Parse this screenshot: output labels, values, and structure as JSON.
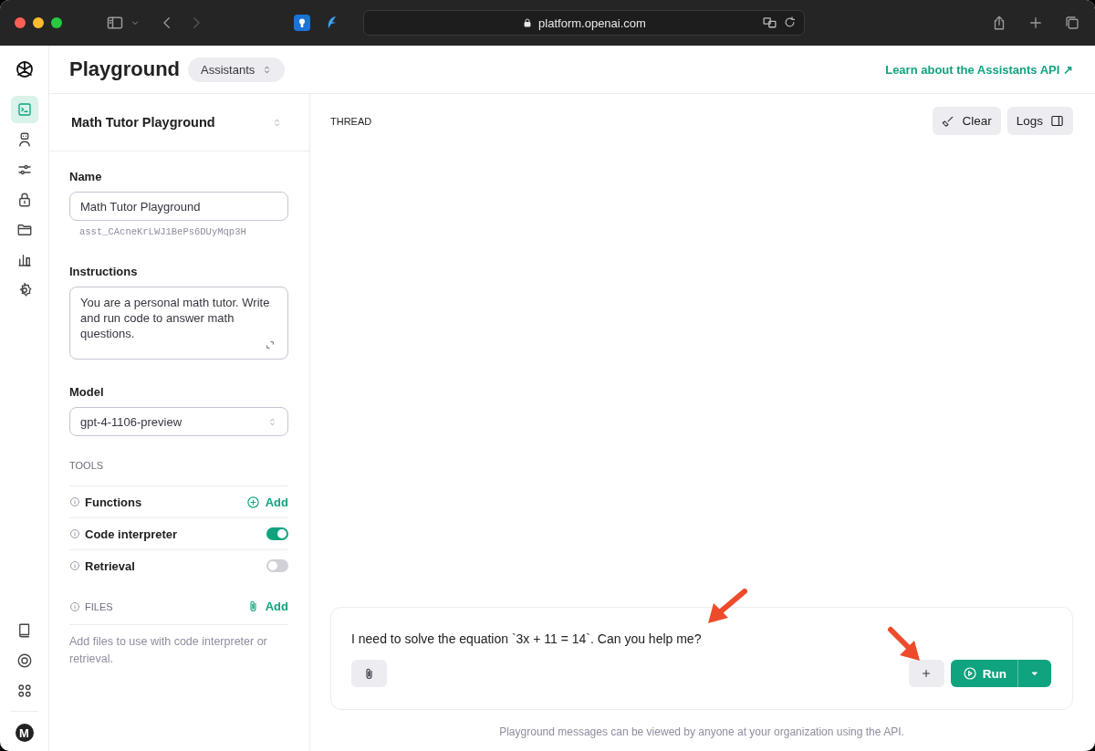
{
  "browser": {
    "url": "platform.openai.com"
  },
  "header": {
    "title": "Playground",
    "mode": "Assistants",
    "link": "Learn about the Assistants API ↗"
  },
  "nav": {
    "items": [
      {
        "selected": true
      },
      {
        "selected": false
      },
      {
        "selected": false
      },
      {
        "selected": false
      },
      {
        "selected": false
      },
      {
        "selected": false
      },
      {
        "selected": false
      }
    ],
    "bottom": [
      {
        "selected": false
      },
      {
        "selected": false
      },
      {
        "selected": false
      }
    ],
    "avatar": "M"
  },
  "assistant": {
    "select": "Math Tutor Playground",
    "name_label": "Name",
    "name": "Math Tutor Playground",
    "id": "asst_CAcneKrLWJ1BePs6DUyMqp3H",
    "instructions_label": "Instructions",
    "instructions": "You are a personal math tutor. Write and run code to answer math questions.",
    "model_label": "Model",
    "model": "gpt-4-1106-preview",
    "tools_heading": "TOOLS",
    "tools": [
      {
        "kind": "add",
        "label": "Functions",
        "action": "Add"
      },
      {
        "kind": "toggle",
        "label": "Code interpreter",
        "on": true
      },
      {
        "kind": "toggle",
        "label": "Retrieval",
        "on": false
      }
    ],
    "files_heading": "FILES",
    "files_action": "Add",
    "files_hint": "Add files to use with code interpreter or retrieval."
  },
  "thread": {
    "heading": "THREAD",
    "buttons": [
      "Clear",
      "Logs"
    ],
    "message": "I need to solve the equation `3x + 11 = 14`. Can you help me?",
    "run": "Run",
    "note": "Playground messages can be viewed by anyone at your organization using the API."
  }
}
